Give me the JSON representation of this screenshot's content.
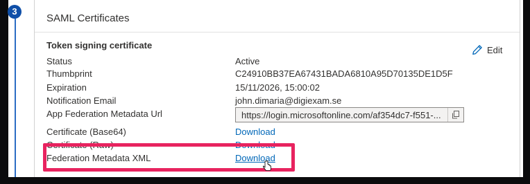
{
  "step": {
    "number": "3"
  },
  "card": {
    "title": "SAML Certificates",
    "section_title": "Token signing certificate",
    "edit_label": "Edit"
  },
  "fields": [
    {
      "label": "Status",
      "value": "Active"
    },
    {
      "label": "Thumbprint",
      "value": "C24910BB37EA67431BADA6810A95D70135DE1D5F"
    },
    {
      "label": "Expiration",
      "value": "15/11/2026, 15:00:02"
    },
    {
      "label": "Notification Email",
      "value": "john.dimaria@digiexam.se"
    },
    {
      "label": "App Federation Metadata Url",
      "value": "https://login.microsoftonline.com/af354dc7-f551-..."
    },
    {
      "label": "Certificate (Base64)",
      "value": "Download"
    },
    {
      "label": "Certificate (Raw)",
      "value": "Download"
    },
    {
      "label": "Federation Metadata XML",
      "value": "Download"
    }
  ],
  "icons": {
    "edit": "pencil-icon",
    "copy": "copy-icon",
    "cursor": "hand-pointer-icon"
  },
  "colors": {
    "link": "#0067b8",
    "highlight": "#e8235f",
    "step_badge": "#0f4fa8"
  }
}
